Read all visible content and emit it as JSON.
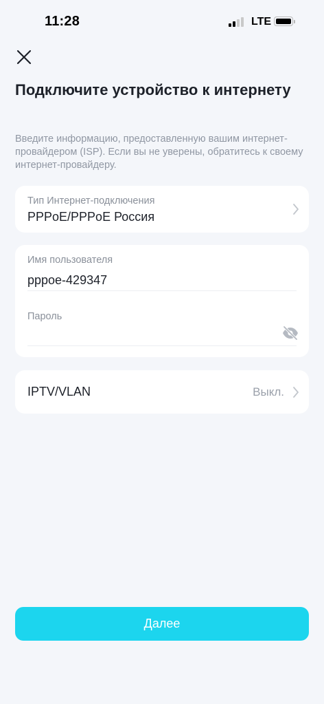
{
  "status_bar": {
    "time": "11:28",
    "network": "LTE"
  },
  "header": {
    "close_icon": "close-icon",
    "title": "Подключите устройство к интернету",
    "description": "Введите информацию, предоставленную вашим интернет-провайдером (ISP). Если вы не уверены, обратитесь к своему интернет-провайдеру."
  },
  "connection": {
    "label": "Тип Интернет-подключения",
    "value": "PPPoE/PPPoE Россия",
    "chevron_icon": "chevron-right-icon"
  },
  "credentials": {
    "username_label": "Имя пользователя",
    "username_value": "pppoe-429347",
    "password_label": "Пароль",
    "password_value": "",
    "visibility_icon": "eye-off-icon"
  },
  "iptv": {
    "label": "IPTV/VLAN",
    "value": "Выкл.",
    "chevron_icon": "chevron-right-icon"
  },
  "footer": {
    "next_label": "Далее"
  },
  "colors": {
    "background": "#f4f6fa",
    "card": "#ffffff",
    "accent": "#1cd5ee",
    "text_primary": "#1d2129",
    "text_secondary": "#8a909a"
  }
}
